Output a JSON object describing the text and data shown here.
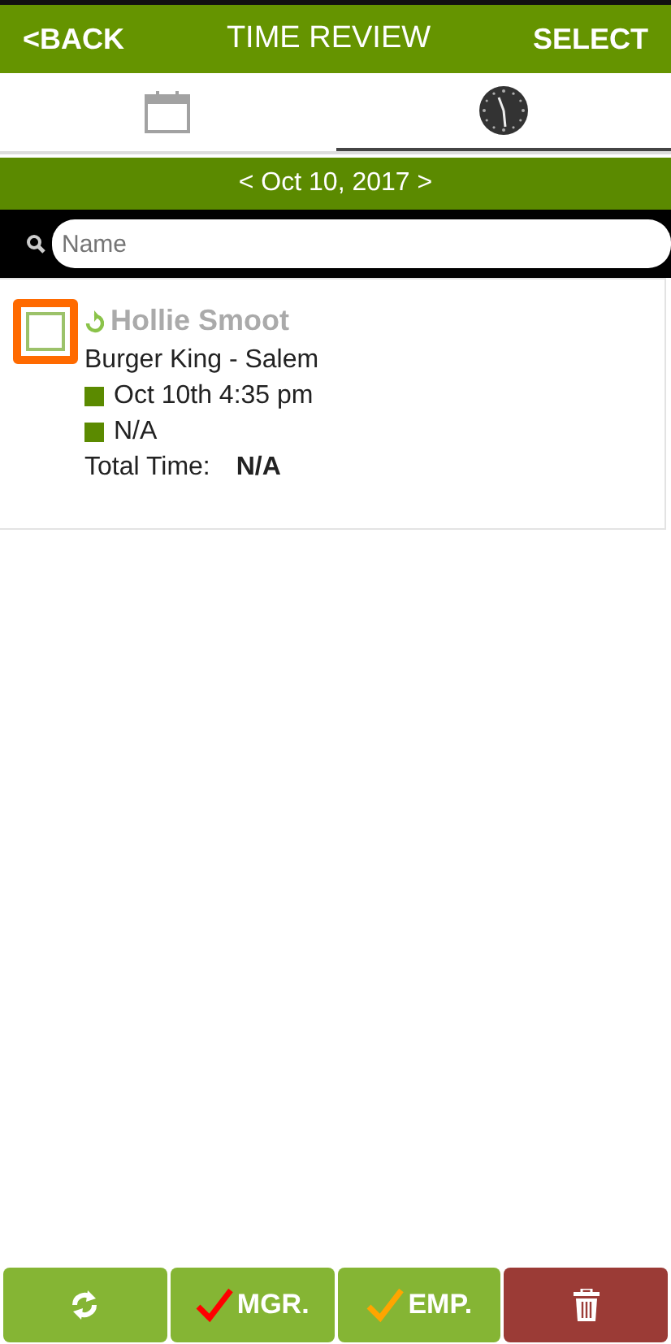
{
  "header": {
    "back": "<BACK",
    "title": "TIME REVIEW",
    "select": "SELECT"
  },
  "tabs": [
    {
      "kind": "calendar",
      "selected": false
    },
    {
      "kind": "clock",
      "selected": true
    }
  ],
  "date_nav": "< Oct 10, 2017 >",
  "search": {
    "placeholder": "Name"
  },
  "entries": [
    {
      "name": "Hollie Smoot",
      "checked": false,
      "focused": true,
      "location": "Burger King - Salem",
      "clock_in": "Oct 10th 4:35 pm",
      "clock_out": "N/A",
      "total_label": "Total Time:",
      "total_value": "N/A"
    }
  ],
  "actions": [
    {
      "kind": "refresh"
    },
    {
      "kind": "check",
      "label": "MGR.",
      "color": "#ff0000"
    },
    {
      "kind": "check",
      "label": "EMP.",
      "color": "#ffa500"
    },
    {
      "kind": "delete"
    }
  ]
}
